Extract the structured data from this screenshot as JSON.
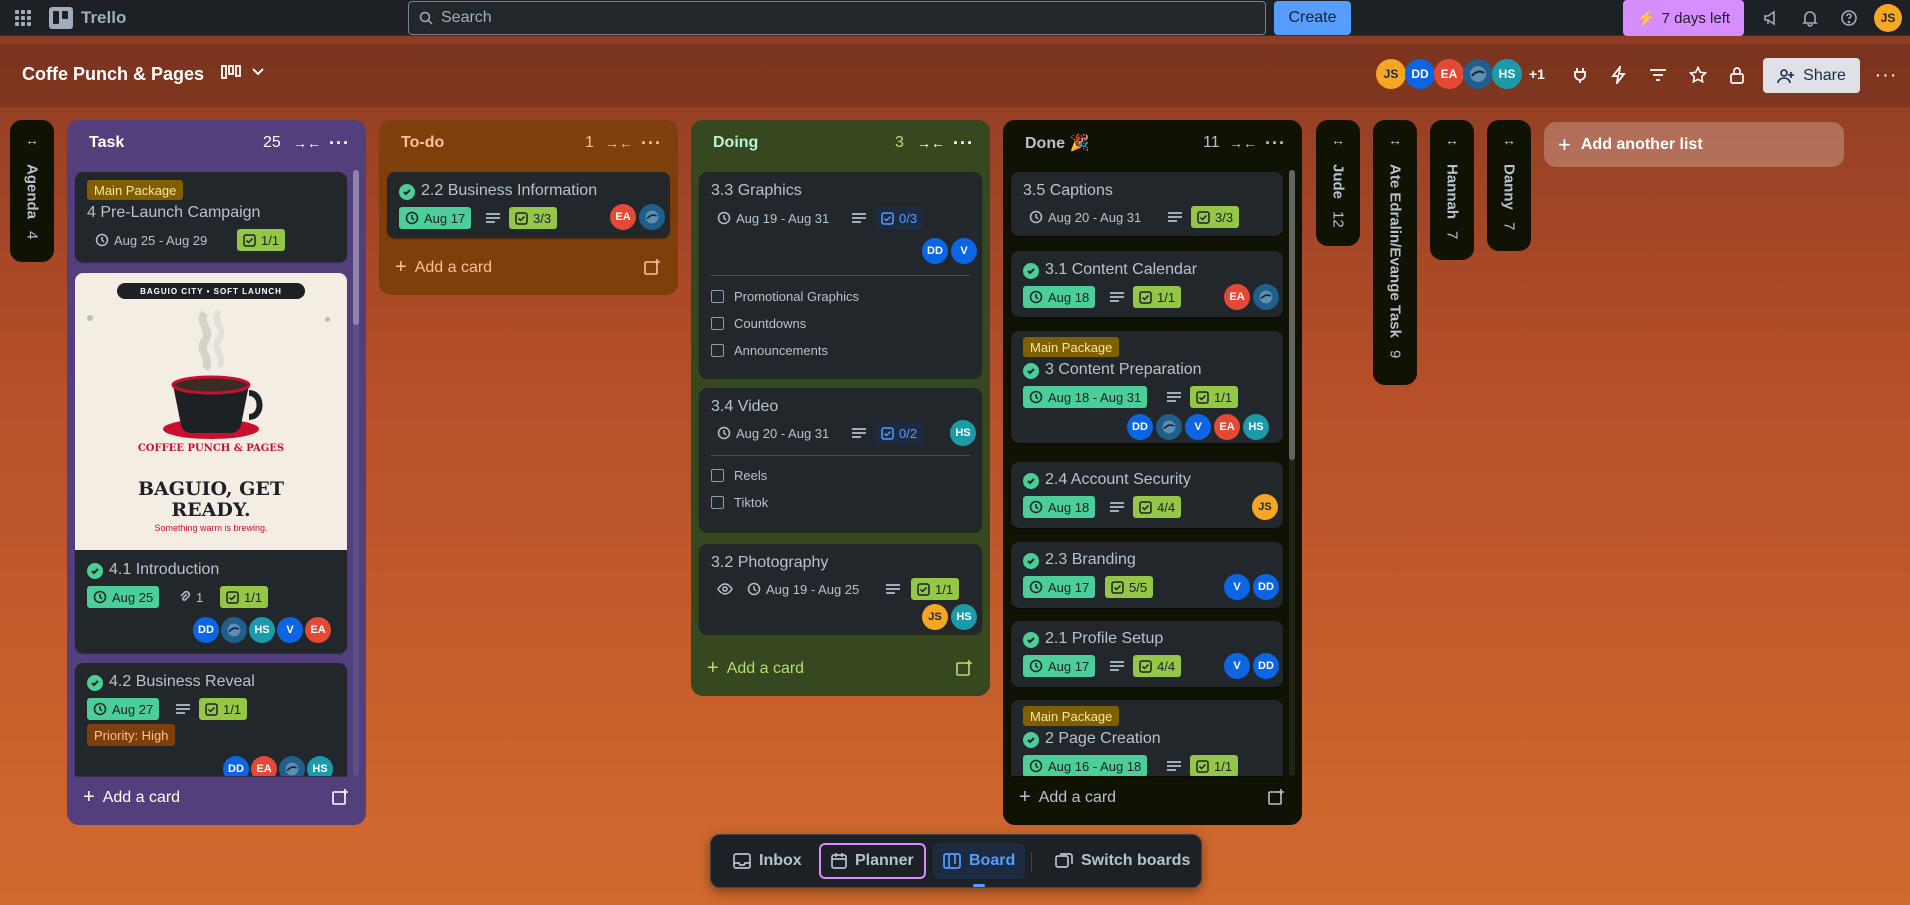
{
  "app": {
    "name": "Trello"
  },
  "search": {
    "placeholder": "Search"
  },
  "create_label": "Create",
  "trial_label": "7 days left",
  "board": {
    "title": "Coffe Punch & Pages",
    "extra_members": "+1",
    "share_label": "Share"
  },
  "colors": {
    "orange": "#f5a623",
    "blue": "#0c66e4",
    "red": "#e34935",
    "teal": "#1d9aaa",
    "slate": "#44546f"
  },
  "lists": {
    "task": {
      "title": "Task",
      "count": "25",
      "cards": [
        {
          "label": "Main Package",
          "title": "4 Pre-Launch Campaign",
          "date": "Aug 25 - Aug 29",
          "check": "1/1"
        },
        {
          "cover": {
            "top": "BAGUIO CITY • SOFT LAUNCH",
            "brand": "COFFEE PUNCH & PAGES",
            "headline": "BAGUIO, GET READY.",
            "tagline": "Something warm is brewing."
          },
          "title": "4.1 Introduction",
          "date": "Aug 25",
          "attachments": "1",
          "check": "1/1",
          "members": [
            "DD",
            "",
            "HS",
            "V",
            "EA"
          ]
        },
        {
          "title": "4.2 Business Reveal",
          "date": "Aug 27",
          "check": "1/1",
          "label": "Priority: High",
          "members": [
            "DD",
            "EA",
            "",
            "HS"
          ]
        }
      ],
      "add": "Add a card"
    },
    "todo": {
      "title": "To-do",
      "count": "1",
      "cards": [
        {
          "title": "2.2 Business Information",
          "date": "Aug 17",
          "check": "3/3",
          "members": [
            "EA",
            ""
          ]
        }
      ],
      "add": "Add a card"
    },
    "doing": {
      "title": "Doing",
      "count": "3",
      "cards": [
        {
          "title": "3.3 Graphics",
          "date": "Aug 19 - Aug 31",
          "check": "0/3",
          "members": [
            "DD",
            "V"
          ],
          "items": [
            "Promotional Graphics",
            "Countdowns",
            "Announcements"
          ]
        },
        {
          "title": "3.4 Video",
          "date": "Aug 20 - Aug 31",
          "check": "0/2",
          "members": [
            "HS"
          ],
          "items": [
            "Reels",
            "Tiktok"
          ]
        },
        {
          "title": "3.2 Photography",
          "date": "Aug 19 - Aug 25",
          "check": "1/1",
          "members": [
            "JS",
            "HS"
          ]
        }
      ],
      "add": "Add a card"
    },
    "done": {
      "title": "Done 🎉",
      "count": "11",
      "cards": [
        {
          "title": "3.5 Captions",
          "date": "Aug 20 - Aug 31",
          "check": "3/3"
        },
        {
          "title": "3.1 Content Calendar",
          "date": "Aug 18",
          "check": "1/1",
          "members": [
            "EA",
            ""
          ]
        },
        {
          "label": "Main Package",
          "title": "3 Content Preparation",
          "date": "Aug 18 - Aug 31",
          "check": "1/1",
          "members": [
            "DD",
            "",
            "V",
            "EA",
            "HS"
          ]
        },
        {
          "title": "2.4 Account Security",
          "date": "Aug 18",
          "check": "4/4",
          "members": [
            "JS"
          ]
        },
        {
          "title": "2.3 Branding",
          "date": "Aug 17",
          "check": "5/5",
          "members": [
            "V",
            "DD"
          ]
        },
        {
          "title": "2.1 Profile Setup",
          "date": "Aug 17",
          "check": "4/4",
          "members": [
            "V",
            "DD"
          ]
        },
        {
          "label": "Main Package",
          "title": "2 Page Creation",
          "date": "Aug 16 - Aug 18",
          "check": "1/1"
        }
      ],
      "add": "Add a card"
    }
  },
  "collapsed": [
    {
      "title": "Agenda",
      "count": "4"
    },
    {
      "title": "Jude",
      "count": "12"
    },
    {
      "title": "Ate Edralin/Evange Task",
      "count": "9"
    },
    {
      "title": "Hannah",
      "count": "7"
    },
    {
      "title": "Danny",
      "count": "7"
    }
  ],
  "add_list": "Add another list",
  "bottom_nav": {
    "inbox": "Inbox",
    "planner": "Planner",
    "board": "Board",
    "switch": "Switch boards"
  },
  "header_members": [
    "JS",
    "DD",
    "EA",
    "",
    "HS"
  ]
}
